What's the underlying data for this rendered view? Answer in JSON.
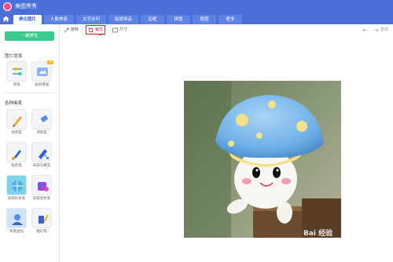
{
  "app": {
    "title": "美图秀秀"
  },
  "tabs": [
    {
      "label": "美化图片"
    },
    {
      "label": "人像美容"
    },
    {
      "label": "文字水印"
    },
    {
      "label": "贴纸饰品"
    },
    {
      "label": "边框"
    },
    {
      "label": "拼图"
    },
    {
      "label": "抠图"
    },
    {
      "label": "更多"
    }
  ],
  "sidebar": {
    "one_key_label": "一键美化",
    "enhance_title": "图片增强",
    "enhance_tools": [
      {
        "label": "增强",
        "icon": "sliders-icon"
      },
      {
        "label": "画质增强",
        "icon": "hd-icon",
        "badge": "VIP"
      }
    ],
    "brush_title": "各种画笔",
    "brush_tools": [
      {
        "label": "涂鸦笔",
        "icon": "pen-icon"
      },
      {
        "label": "消除笔",
        "icon": "eraser-icon"
      },
      {
        "label": "取色笔",
        "icon": "color-brush-icon"
      },
      {
        "label": "局部马赛克",
        "icon": "mosaic-icon"
      },
      {
        "label": "局部彩色笔",
        "icon": "colorize-icon"
      },
      {
        "label": "局部变色笔",
        "icon": "recolor-icon"
      },
      {
        "label": "背景虚化",
        "icon": "blur-icon"
      },
      {
        "label": "魔幻笔",
        "icon": "magic-icon"
      }
    ]
  },
  "toolbar": {
    "rotate_label": "旋转",
    "crop_label": "裁剪",
    "resize_label": "尺寸",
    "undo_label": "",
    "redo_label": "重做"
  },
  "colors": {
    "brand_blue": "#4a6fd8",
    "accent_green": "#3cc98c",
    "highlight_red": "#e02020"
  },
  "canvas": {
    "watermark_text": "Bai 经验"
  }
}
